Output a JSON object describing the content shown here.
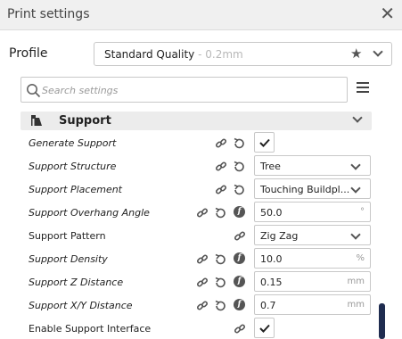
{
  "window": {
    "title": "Print settings",
    "close_symbol": "✕"
  },
  "profile": {
    "label": "Profile",
    "name": "Standard Quality",
    "subtitle": " - 0.2mm",
    "star_icon": "star-icon"
  },
  "search": {
    "placeholder": "Search settings"
  },
  "category": {
    "label": "Support",
    "icon": "support-icon"
  },
  "settings": [
    {
      "label": "Generate Support",
      "italic": true,
      "type": "checkbox",
      "checked": true
    },
    {
      "label": "Support Structure",
      "italic": true,
      "type": "select",
      "value": "Tree"
    },
    {
      "label": "Support Placement",
      "italic": true,
      "type": "select",
      "value": "Touching Buildpl..."
    },
    {
      "label": "Support Overhang Angle",
      "italic": true,
      "type": "number",
      "value": "50.0",
      "unit": "°"
    },
    {
      "label": "Support Pattern",
      "italic": false,
      "type": "select",
      "value": "Zig Zag"
    },
    {
      "label": "Support Density",
      "italic": true,
      "type": "number",
      "value": "10.0",
      "unit": "%"
    },
    {
      "label": "Support Z Distance",
      "italic": true,
      "type": "number",
      "value": "0.15",
      "unit": "mm"
    },
    {
      "label": "Support X/Y Distance",
      "italic": true,
      "type": "number",
      "value": "0.7",
      "unit": "mm"
    },
    {
      "label": "Enable Support Interface",
      "italic": false,
      "type": "checkbox",
      "checked": true
    }
  ],
  "colors": {
    "accent": "#1f2c50",
    "header_bg": "#ececec"
  }
}
